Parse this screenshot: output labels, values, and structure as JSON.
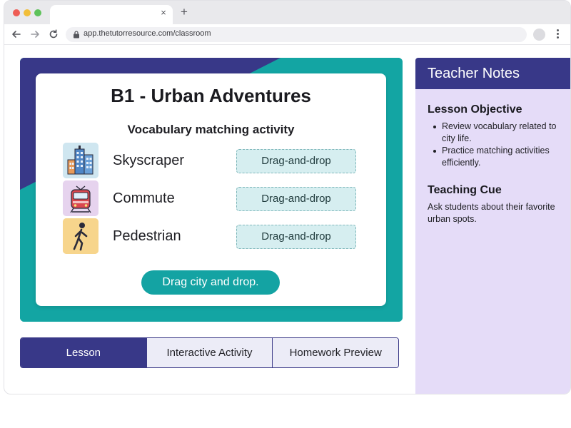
{
  "browser": {
    "url": "app.thetutorresource.com/classroom",
    "new_tab_label": "+",
    "close_tab_label": "×"
  },
  "lesson": {
    "title": "B1 - Urban Adventures",
    "subtitle": "Vocabulary matching activity",
    "items": [
      {
        "word": "Skyscraper",
        "icon": "skyscraper-icon",
        "drop_label": "Drag-and-drop"
      },
      {
        "word": "Commute",
        "icon": "train-icon",
        "drop_label": "Drag-and-drop"
      },
      {
        "word": "Pedestrian",
        "icon": "pedestrian-icon",
        "drop_label": "Drag-and-drop"
      }
    ],
    "action_button": "Drag city and drop."
  },
  "tabs": [
    {
      "label": "Lesson",
      "active": true
    },
    {
      "label": "Interactive Activity",
      "active": false
    },
    {
      "label": "Homework Preview",
      "active": false
    }
  ],
  "teacher_notes": {
    "title": "Teacher Notes",
    "objective_heading": "Lesson Objective",
    "objectives": [
      "Review vocabulary related to city life.",
      "Practice matching activities efficiently."
    ],
    "cue_heading": "Teaching Cue",
    "cue_text": "Ask students about their favorite urban spots."
  },
  "colors": {
    "brand_purple": "#383888",
    "brand_teal": "#13a5a3",
    "notes_background": "#e5dcf8",
    "drop_zone": "#d6eef0"
  }
}
